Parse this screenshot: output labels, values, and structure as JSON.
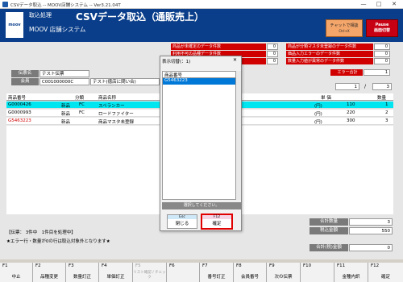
{
  "window": {
    "title": "CSVデータ取込 -- MOOV店舗システム -- Ver3.21.04T",
    "min": "—",
    "max": "□",
    "close": "✕"
  },
  "header": {
    "logo": "moov",
    "module": "取込処理",
    "title": "CSVデータ取込（通販売上）",
    "system": "MOOV 店舗システム",
    "chat_label": "チャットで相談",
    "chat_sub": "Ctrl+X",
    "pause_line1": "Pause",
    "pause_line2": "画面切替"
  },
  "errors": {
    "left": [
      {
        "label": "商品が未確定のデータ件数",
        "count": "0"
      },
      {
        "label": "利用不可の品種データ件数",
        "count": "0"
      },
      {
        "label": "商品区分が異常のデータ件数",
        "count": "0"
      }
    ],
    "right": [
      {
        "label": "商品が分類マスタ未登録のデータ件数",
        "count": "0"
      },
      {
        "label": "価品入力エラーのデータ件数",
        "count": "0"
      },
      {
        "label": "数量入力値が異常のデータ件数",
        "count": "0"
      }
    ],
    "total_label": "エラー合計",
    "total": "1"
  },
  "slip": {
    "label": "伝票名",
    "value": "テスト伝票",
    "member_label": "会員",
    "member_value": "C001000000C",
    "member_name": "テスト(徳店に問い合)",
    "page_current": "1",
    "page_sep": "/",
    "page_total": "3"
  },
  "grid": {
    "headers": [
      "商品番号",
      "分類",
      "商品名称",
      "単 価",
      "数量"
    ],
    "rows": [
      {
        "code": "G0000426",
        "cat1": "新品",
        "cat2": "FC",
        "name": "スペランカー",
        "yen": "(円)",
        "price": "110",
        "qty": "1"
      },
      {
        "code": "G0000993",
        "cat1": "新品",
        "cat2": "FC",
        "name": "ロードファイター",
        "yen": "(円)",
        "price": "220",
        "qty": "2"
      },
      {
        "code": "G5463223",
        "cat1": "新品",
        "cat2": "",
        "name": "商品マスタ未登録",
        "yen": "(円)",
        "price": "300",
        "qty": "3"
      }
    ]
  },
  "dialog": {
    "title": "表示切替(：1)",
    "col": "商品番号",
    "item": "G5463223",
    "status": "選択してください。",
    "close_key": "Esc",
    "close_label": "閉じる",
    "ok_key": "F12",
    "ok_label": "確定"
  },
  "footer": {
    "info": "【伝票： 3件中　1件目を処理中】",
    "note": "★エラー行・数量が0の行は取込対象外となります★",
    "qty_label": "合計数量",
    "qty": "3",
    "tax_label": "税込金額",
    "tax": "550",
    "ship_label": "合計(税)金額",
    "ship": "0"
  },
  "fkeys": [
    {
      "n": "F1",
      "l": "中止"
    },
    {
      "n": "F2",
      "l": "品種変更"
    },
    {
      "n": "F3",
      "l": "数量訂正"
    },
    {
      "n": "F4",
      "l": "単価訂正"
    },
    {
      "n": "F5",
      "l": "リスト確認 / チェック"
    },
    {
      "n": "F6",
      "l": ""
    },
    {
      "n": "F7",
      "l": "番号訂正"
    },
    {
      "n": "F8",
      "l": "会員番号"
    },
    {
      "n": "F9",
      "l": "次の伝票"
    },
    {
      "n": "F10",
      "l": ""
    },
    {
      "n": "F11",
      "l": "金種内訳"
    },
    {
      "n": "F12",
      "l": "確定"
    }
  ]
}
